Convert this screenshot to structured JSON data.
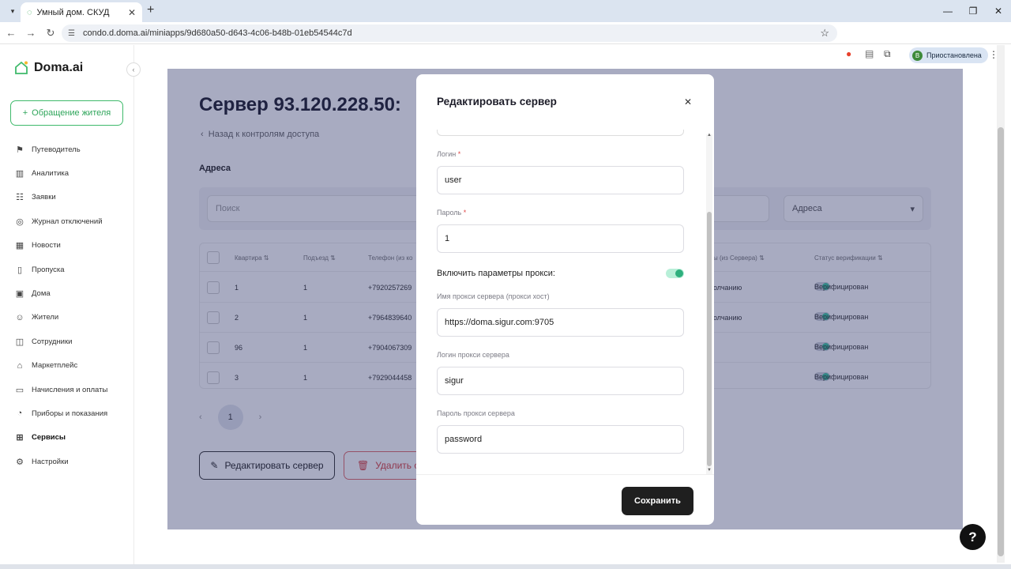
{
  "browser": {
    "tab_title": "Умный дом. СКУД",
    "url": "condo.d.doma.ai/miniapps/9d680a50-d643-4c06-b48b-01eb54544c7d",
    "profile_label": "Приостановлена",
    "profile_initial": "В"
  },
  "sidebar": {
    "logo_text": "Doma.ai",
    "appeal_button": "Обращение жителя",
    "items": [
      {
        "label": "Путеводитель",
        "icon": "signpost-icon"
      },
      {
        "label": "Аналитика",
        "icon": "bar-chart-icon"
      },
      {
        "label": "Заявки",
        "icon": "list-icon"
      },
      {
        "label": "Журнал отключений",
        "icon": "journal-icon"
      },
      {
        "label": "Новости",
        "icon": "news-icon"
      },
      {
        "label": "Пропуска",
        "icon": "pass-icon"
      },
      {
        "label": "Дома",
        "icon": "building-icon"
      },
      {
        "label": "Жители",
        "icon": "residents-icon"
      },
      {
        "label": "Сотрудники",
        "icon": "employees-icon"
      },
      {
        "label": "Маркетплейс",
        "icon": "marketplace-icon"
      },
      {
        "label": "Начисления и оплаты",
        "icon": "wallet-icon"
      },
      {
        "label": "Приборы и показания",
        "icon": "meter-icon"
      },
      {
        "label": "Сервисы",
        "icon": "services-icon",
        "active": true
      },
      {
        "label": "Настройки",
        "icon": "gear-icon"
      }
    ]
  },
  "main": {
    "title": "Сервер 93.120.228.50:",
    "back_link": "Назад к контролям доступа",
    "section_title": "Адреса",
    "search_placeholder": "Поиск",
    "address_select": "Адреса",
    "columns": [
      "Квартира ⇅",
      "Подъезд ⇅",
      "Телефон (из ко",
      "ы (из Сервера) ⇅",
      "Статус верификации ⇅"
    ],
    "rows": [
      {
        "apartment": "1",
        "entrance": "1",
        "phone": "+7920257269",
        "server": "олчанию",
        "status": "Верифицирован"
      },
      {
        "apartment": "2",
        "entrance": "1",
        "phone": "+7964839640",
        "server": "олчанию",
        "status": "Верифицирован"
      },
      {
        "apartment": "96",
        "entrance": "1",
        "phone": "+7904067309",
        "server": "",
        "status": "Верифицирован"
      },
      {
        "apartment": "3",
        "entrance": "1",
        "phone": "+7929044458",
        "server": "",
        "status": "Верифицирован"
      }
    ],
    "current_page": "1",
    "edit_server_button": "Редактировать сервер",
    "delete_server_button": "Удалить се"
  },
  "modal": {
    "title": "Редактировать сервер",
    "login_label": "Логин",
    "login_value": "user",
    "password_label": "Пароль",
    "password_value": "1",
    "proxy_toggle_label": "Включить параметры прокси:",
    "proxy_enabled": true,
    "proxy_host_label": "Имя прокси сервера (прокси хост)",
    "proxy_host_value": "https://doma.sigur.com:9705",
    "proxy_login_label": "Логин прокси сервера",
    "proxy_login_value": "sigur",
    "proxy_password_label": "Пароль прокси сервера",
    "proxy_password_value": "password",
    "save_button": "Сохранить"
  },
  "colors": {
    "accent_green": "#3fba6b",
    "toggle_on": "#2eaf7d",
    "danger": "#d84040",
    "overlay": "#262c64"
  }
}
